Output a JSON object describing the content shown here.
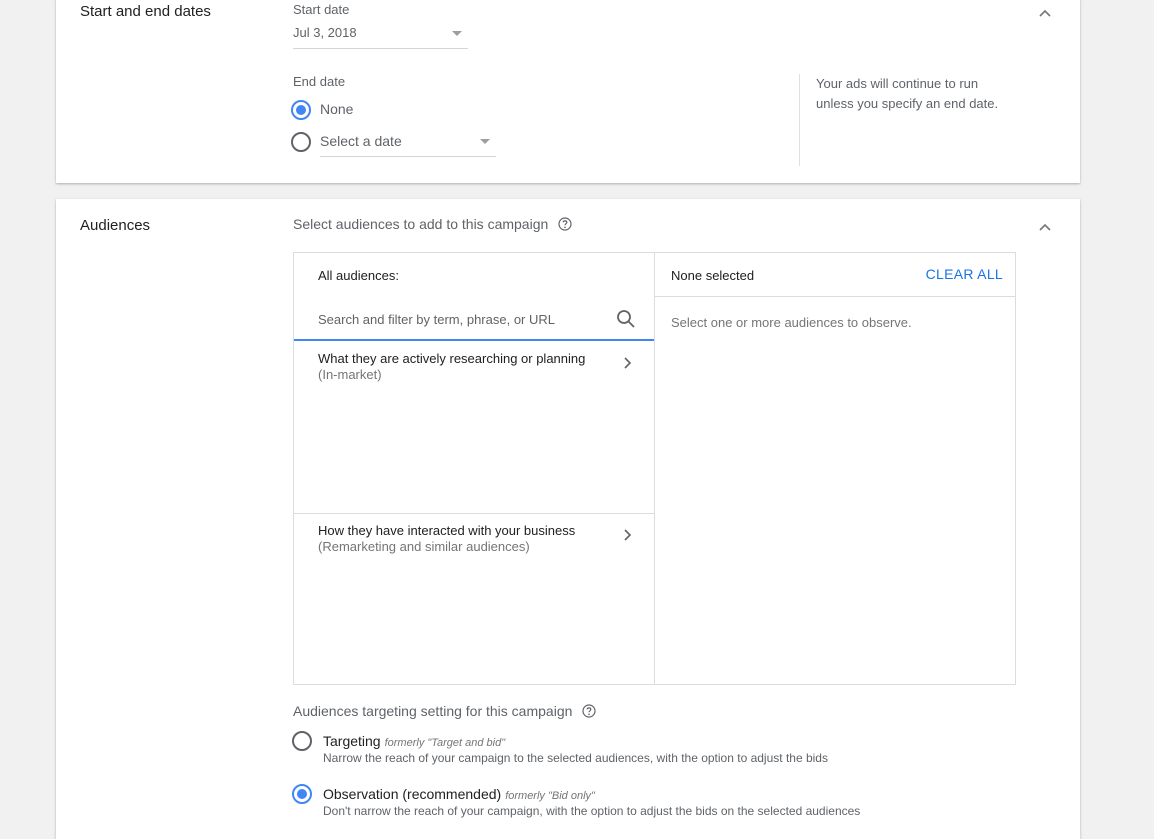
{
  "dates_section": {
    "title": "Start and end dates",
    "start_label": "Start date",
    "start_value": "Jul 3, 2018",
    "end_label": "End date",
    "end_options": [
      {
        "label": "None",
        "selected": true
      },
      {
        "label": "Select a date",
        "selected": false
      }
    ],
    "hint": "Your ads will continue to run unless you specify an end date."
  },
  "audiences_section": {
    "title": "Audiences",
    "subtitle": "Select audiences to add to this campaign",
    "left_header": "All audiences:",
    "search_placeholder": "Search and filter by term, phrase, or URL",
    "categories": [
      {
        "title": "What they are actively researching or planning",
        "subtitle": "(In-market)"
      },
      {
        "title": "How they have interacted with your business",
        "subtitle": "(Remarketing and similar audiences)"
      }
    ],
    "right_header": "None selected",
    "clear_all": "CLEAR ALL",
    "right_message": "Select one or more audiences to observe.",
    "targeting_heading": "Audiences targeting setting for this campaign",
    "targeting_options": [
      {
        "title": "Targeting",
        "formerly": "formerly \"Target and bid\"",
        "description": "Narrow the reach of your campaign to the selected audiences, with the option to adjust the bids",
        "selected": false
      },
      {
        "title": "Observation (recommended)",
        "formerly": "formerly \"Bid only\"",
        "description": "Don't narrow the reach of your campaign, with the option to adjust the bids on the selected audiences",
        "selected": true
      }
    ]
  },
  "colors": {
    "accent": "#4285f4",
    "link": "#1a73e8",
    "background": "#f1f1f1"
  }
}
